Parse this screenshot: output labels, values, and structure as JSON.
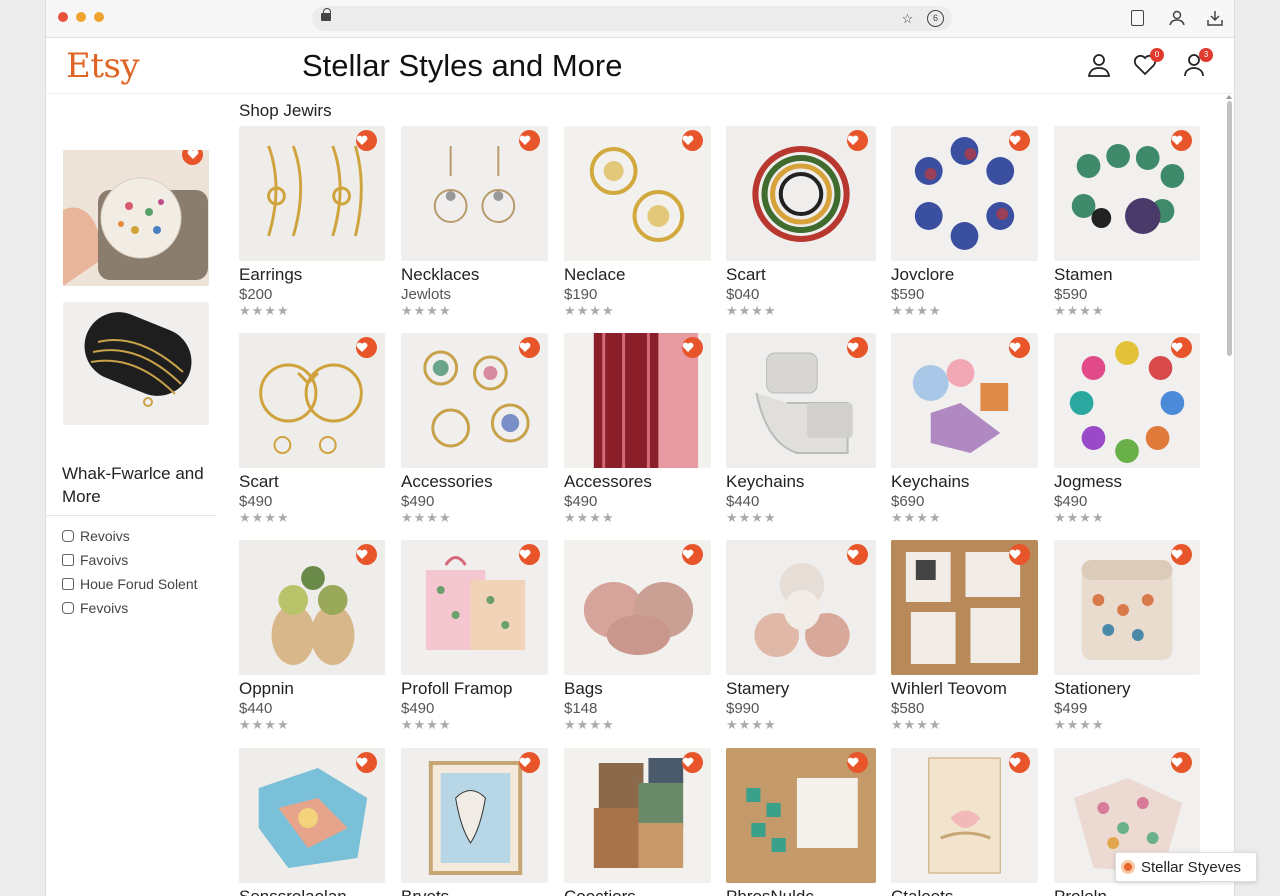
{
  "browser": {
    "extension_icon": "puzzle-star-icon",
    "tab_count": "6"
  },
  "header": {
    "logo": "Etsy",
    "shop_title": "Stellar Styles and More",
    "heart_badge": "0",
    "account_badge": "3"
  },
  "sidebar": {
    "title": "Whak-Fwarlce and More",
    "items": [
      {
        "label": "Revoivs",
        "icon": "bag-icon"
      },
      {
        "label": "Favoivs",
        "icon": "card-icon"
      },
      {
        "label": "Houe Forud Solent",
        "icon": "store-icon"
      },
      {
        "label": "Fevoivs",
        "icon": "camera-icon"
      }
    ]
  },
  "section_title": "Shop Jewirs",
  "stars": "★★★★",
  "products": [
    {
      "name": "Earrings",
      "price": "$200"
    },
    {
      "name": "Necklaces",
      "price": "Jewlots"
    },
    {
      "name": "Neclace",
      "price": "$190"
    },
    {
      "name": "Scart",
      "price": "$040"
    },
    {
      "name": "Jovclore",
      "price": "$590"
    },
    {
      "name": "Stamen",
      "price": "$590"
    },
    {
      "name": "Scart",
      "price": "$490"
    },
    {
      "name": "Accessories",
      "price": "$490"
    },
    {
      "name": "Accessores",
      "price": "$490"
    },
    {
      "name": "Keychains",
      "price": "$440"
    },
    {
      "name": "Keychains",
      "price": "$690"
    },
    {
      "name": "Jogmess",
      "price": "$490"
    },
    {
      "name": "Oppnin",
      "price": "$440"
    },
    {
      "name": "Profoll Framop",
      "price": "$490"
    },
    {
      "name": "Bags",
      "price": "$148"
    },
    {
      "name": "Stamery",
      "price": "$990"
    },
    {
      "name": "Wihlerl Teovom",
      "price": "$580"
    },
    {
      "name": "Stationery",
      "price": "$499"
    },
    {
      "name": "Senssrolaolan",
      "price": ""
    },
    {
      "name": "Brvets",
      "price": ""
    },
    {
      "name": "Cooctiors",
      "price": ""
    },
    {
      "name": "PhrosNuldc",
      "price": ""
    },
    {
      "name": "Ctaleets",
      "price": ""
    },
    {
      "name": "Proleln",
      "price": ""
    }
  ],
  "toast": {
    "label": "Stellar Styeves"
  },
  "colors": {
    "brand": "#e06424",
    "favorite": "#e8552a",
    "badge": "#e03a2f"
  }
}
